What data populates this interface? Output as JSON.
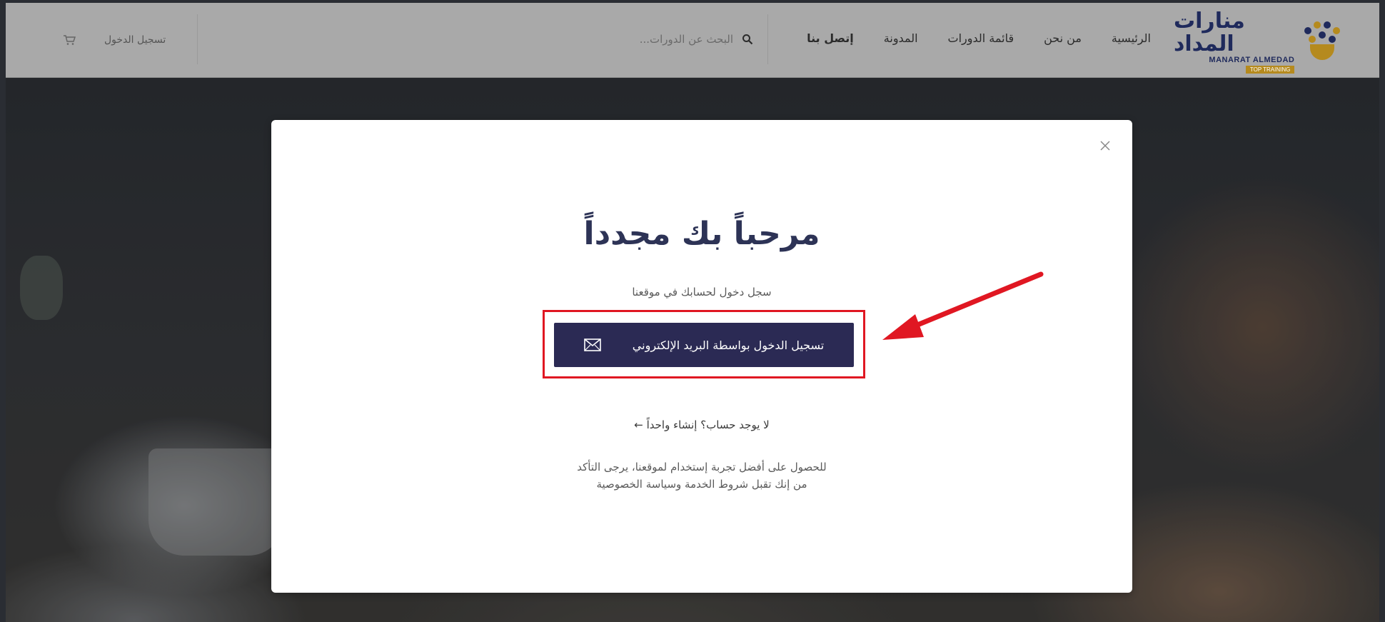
{
  "header": {
    "logo": {
      "arabic": "منارات المداد",
      "english": "MANARAT ALMEDAD",
      "tag": "TOP TRAINING"
    },
    "nav": [
      {
        "label": "الرئيسية"
      },
      {
        "label": "من نحن"
      },
      {
        "label": "قائمة الدورات"
      },
      {
        "label": "المدونة"
      },
      {
        "label": "إتصل بنا"
      }
    ],
    "search": {
      "placeholder": "البحث عن الدورات..."
    },
    "login_label": "تسجيل الدخول"
  },
  "modal": {
    "title": "مرحباً بك مجدداً",
    "subtitle": "سجل دخول لحسابك في موقعنا",
    "email_button_label": "تسجيل الدخول بواسطة البريد الإلكتروني",
    "signup_text": "لا يوجد حساب؟ إنشاء واحداً ←",
    "terms_text": "للحصول على أفضل تجربة إستخدام لموقعنا، يرجى التأكد من إنك تقبل شروط الخدمة وسياسة الخصوصية"
  },
  "colors": {
    "header_bg": "#a9a9a9",
    "brand_navy": "#2b2a54",
    "brand_gold": "#b58a1e",
    "annotation_red": "#e01722"
  },
  "icons": [
    "search-icon",
    "cart-icon",
    "close-icon",
    "mail-icon",
    "logo-icon",
    "arrow-annotation"
  ]
}
